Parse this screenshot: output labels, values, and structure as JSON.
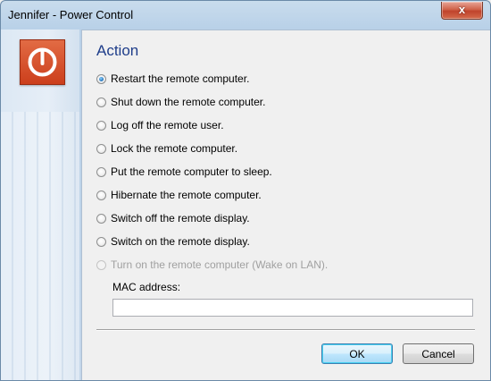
{
  "window": {
    "title": "Jennifer - Power Control"
  },
  "close_symbol": "x",
  "icon": {
    "name": "power-icon",
    "accent": "#d54c25"
  },
  "action": {
    "heading": "Action",
    "options": [
      {
        "label": "Restart the remote computer.",
        "checked": true,
        "disabled": false
      },
      {
        "label": "Shut down the remote computer.",
        "checked": false,
        "disabled": false
      },
      {
        "label": "Log off the remote user.",
        "checked": false,
        "disabled": false
      },
      {
        "label": "Lock the remote computer.",
        "checked": false,
        "disabled": false
      },
      {
        "label": "Put the remote computer to sleep.",
        "checked": false,
        "disabled": false
      },
      {
        "label": "Hibernate the remote computer.",
        "checked": false,
        "disabled": false
      },
      {
        "label": "Switch off the remote display.",
        "checked": false,
        "disabled": false
      },
      {
        "label": "Switch on the remote display.",
        "checked": false,
        "disabled": false
      },
      {
        "label": "Turn on the remote computer (Wake on LAN).",
        "checked": false,
        "disabled": true
      }
    ],
    "mac_label": "MAC address:",
    "mac_value": ""
  },
  "buttons": {
    "ok": "OK",
    "cancel": "Cancel"
  }
}
